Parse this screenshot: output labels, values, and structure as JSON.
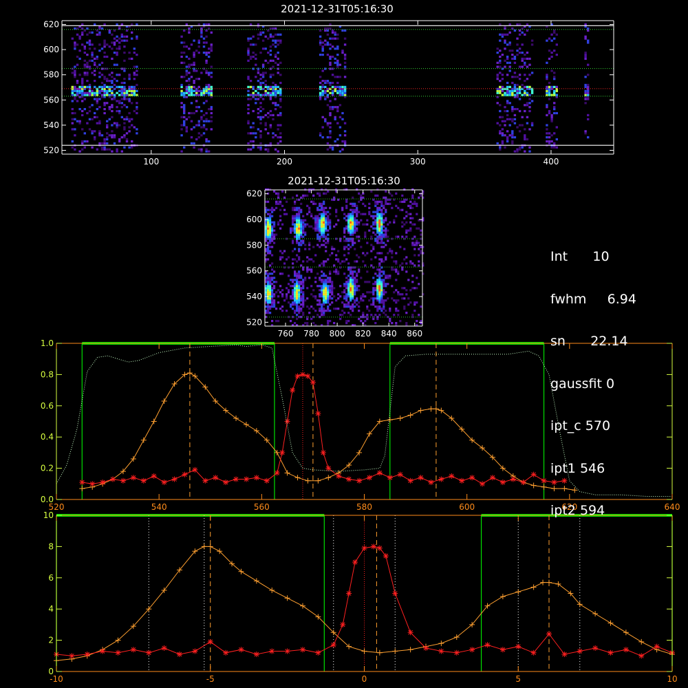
{
  "colors": {
    "background": "#000000",
    "axis_white": "#ffffff",
    "axis_orange": "#ff8c1a",
    "axis_yellow": "#d8ff40",
    "green_band": "#00e000",
    "series_orange": "#ffa030",
    "series_red": "#ff2020",
    "transmission": "#c8ffc8"
  },
  "panels": {
    "top_image": {
      "title": "2021-12-31T05:16:30",
      "xlim": [
        33,
        447
      ],
      "ylim": [
        517,
        623
      ],
      "xticks": [
        100,
        200,
        300,
        400
      ],
      "yticks": [
        520,
        540,
        560,
        580,
        600,
        620
      ],
      "hlines": [
        {
          "y": 616,
          "color": "#30c030",
          "style": "dotted"
        },
        {
          "y": 585,
          "color": "#30c030",
          "style": "dotted"
        },
        {
          "y": 569,
          "color": "#e02020",
          "style": "dotted"
        },
        {
          "y": 563,
          "color": "#30c030",
          "style": "dotted"
        },
        {
          "y": 524,
          "color": "#ffffff",
          "style": "solid"
        },
        {
          "y": 619,
          "color": "#ffffff",
          "style": "solid"
        }
      ],
      "stripes": [
        [
          40,
          90
        ],
        [
          122,
          145
        ],
        [
          172,
          197
        ],
        [
          226,
          246
        ],
        [
          359,
          386
        ],
        [
          396,
          405
        ],
        [
          425,
          428
        ]
      ]
    },
    "mid_image": {
      "title": "2021-12-31T05:16:30",
      "xlim": [
        744,
        866
      ],
      "ylim": [
        517,
        623
      ],
      "xticks": [
        760,
        780,
        800,
        820,
        840,
        860
      ],
      "yticks": [
        520,
        540,
        560,
        580,
        600,
        620
      ],
      "hlines": [
        {
          "y": 616
        },
        {
          "y": 585
        },
        {
          "y": 563
        },
        {
          "y": 524
        }
      ],
      "blobs": [
        [
          746,
          592
        ],
        [
          746,
          542
        ],
        [
          769,
          592
        ],
        [
          768,
          542
        ],
        [
          788,
          596
        ],
        [
          790,
          542
        ],
        [
          810,
          596
        ],
        [
          810,
          545
        ],
        [
          832,
          596
        ],
        [
          832,
          545
        ]
      ]
    }
  },
  "info": {
    "int_label": "Int",
    "int_value": "10",
    "fwhm_label": "fwhm",
    "fwhm_value": "6.94",
    "sn_label": "sn",
    "sn_value": "22.14",
    "gaussfit_label": "gaussfit",
    "gaussfit_value": "0",
    "ipt_c_label": "ipt_c",
    "ipt_c_value": "570",
    "ipt1_label": "ipt1",
    "ipt1_value": "546",
    "ipt2_label": "ipt2",
    "ipt2_value": "594"
  },
  "chart_data": [
    {
      "type": "line",
      "xlim": [
        520,
        640
      ],
      "ylim": [
        0,
        1.0
      ],
      "xticks": [
        520,
        540,
        560,
        580,
        600,
        620,
        640
      ],
      "yticks": [
        0.0,
        0.2,
        0.4,
        0.6,
        0.8,
        1.0
      ],
      "green_bands": [
        [
          525,
          562.5
        ],
        [
          585,
          615
        ]
      ],
      "vlines_orange_dashed": [
        546,
        570,
        594
      ],
      "vlines_red_dotted": [
        568
      ],
      "series": [
        {
          "color": "#ffa030",
          "marker": "plus",
          "x": [
            525,
            527,
            529,
            531,
            533,
            535,
            537,
            539,
            541,
            543,
            545,
            546,
            547,
            549,
            551,
            553,
            555,
            557,
            559,
            561,
            563,
            565,
            567,
            569,
            571,
            573,
            575,
            577,
            579,
            581,
            583,
            585,
            587,
            589,
            591,
            593,
            594,
            595,
            597,
            599,
            601,
            603,
            605,
            607,
            609,
            611,
            613,
            615,
            617,
            619,
            621
          ],
          "y": [
            0.07,
            0.08,
            0.1,
            0.13,
            0.18,
            0.26,
            0.38,
            0.5,
            0.63,
            0.74,
            0.8,
            0.81,
            0.79,
            0.72,
            0.63,
            0.57,
            0.52,
            0.48,
            0.44,
            0.38,
            0.3,
            0.17,
            0.14,
            0.12,
            0.12,
            0.14,
            0.17,
            0.22,
            0.3,
            0.42,
            0.5,
            0.51,
            0.52,
            0.54,
            0.57,
            0.58,
            0.58,
            0.57,
            0.52,
            0.45,
            0.38,
            0.33,
            0.27,
            0.2,
            0.15,
            0.11,
            0.09,
            0.08,
            0.07,
            0.07,
            0.06
          ]
        },
        {
          "color": "#ff2020",
          "marker": "star",
          "x": [
            525,
            527,
            529,
            531,
            533,
            535,
            537,
            539,
            541,
            543,
            545,
            547,
            549,
            551,
            553,
            555,
            557,
            559,
            561,
            563,
            564,
            565,
            566,
            567,
            568,
            569,
            570,
            571,
            572,
            573,
            575,
            577,
            579,
            581,
            583,
            585,
            587,
            589,
            591,
            593,
            595,
            597,
            599,
            601,
            603,
            605,
            607,
            609,
            611,
            613,
            615,
            617,
            619
          ],
          "y": [
            0.11,
            0.1,
            0.11,
            0.13,
            0.12,
            0.14,
            0.12,
            0.15,
            0.11,
            0.13,
            0.16,
            0.19,
            0.12,
            0.14,
            0.11,
            0.13,
            0.13,
            0.14,
            0.12,
            0.17,
            0.3,
            0.5,
            0.7,
            0.79,
            0.8,
            0.79,
            0.75,
            0.55,
            0.3,
            0.2,
            0.15,
            0.13,
            0.12,
            0.14,
            0.17,
            0.14,
            0.16,
            0.12,
            0.14,
            0.11,
            0.13,
            0.15,
            0.12,
            0.14,
            0.1,
            0.14,
            0.11,
            0.13,
            0.11,
            0.16,
            0.12,
            0.11,
            0.12
          ]
        },
        {
          "color": "#c8ffc8",
          "style": "dotted",
          "x": [
            520,
            522,
            524,
            526,
            528,
            530,
            532,
            534,
            536,
            540,
            545,
            550,
            555,
            557,
            560,
            562,
            564,
            566,
            568,
            570,
            575,
            580,
            583,
            584,
            586,
            588,
            592,
            600,
            608,
            612,
            614,
            616,
            618,
            620,
            622,
            625,
            630,
            635,
            640
          ],
          "y": [
            0.1,
            0.22,
            0.45,
            0.82,
            0.91,
            0.92,
            0.9,
            0.88,
            0.89,
            0.94,
            0.97,
            0.98,
            0.99,
            0.98,
            0.99,
            0.97,
            0.65,
            0.3,
            0.2,
            0.19,
            0.18,
            0.19,
            0.2,
            0.28,
            0.85,
            0.92,
            0.93,
            0.93,
            0.93,
            0.95,
            0.92,
            0.8,
            0.45,
            0.12,
            0.05,
            0.03,
            0.03,
            0.02,
            0.02
          ]
        }
      ]
    },
    {
      "type": "line",
      "xlim": [
        -10,
        10
      ],
      "ylim": [
        0,
        10
      ],
      "xticks": [
        -10,
        -5,
        0,
        5,
        10
      ],
      "yticks": [
        0,
        2,
        4,
        6,
        8,
        10
      ],
      "green_bands": [
        [
          -10,
          -1.3
        ],
        [
          3.8,
          10
        ]
      ],
      "vlines_orange_dashed": [
        -5,
        0.4,
        6
      ],
      "vlines_white_dotted": [
        -7,
        -5.2,
        -1,
        1,
        5,
        7
      ],
      "vlines_red_dotted": [
        0
      ],
      "series": [
        {
          "color": "#ffa030",
          "marker": "plus",
          "x": [
            -10,
            -9.5,
            -9,
            -8.5,
            -8,
            -7.5,
            -7,
            -6.5,
            -6,
            -5.5,
            -5.2,
            -5,
            -4.7,
            -4.3,
            -4,
            -3.5,
            -3,
            -2.5,
            -2,
            -1.5,
            -1,
            -0.5,
            0,
            0.5,
            1,
            1.5,
            2,
            2.5,
            3,
            3.5,
            4,
            4.5,
            5,
            5.5,
            5.8,
            6,
            6.3,
            6.7,
            7,
            7.5,
            8,
            8.5,
            9,
            9.5,
            10
          ],
          "y": [
            0.7,
            0.8,
            1.0,
            1.4,
            2.0,
            2.9,
            4.0,
            5.2,
            6.5,
            7.7,
            8.0,
            8.0,
            7.7,
            6.9,
            6.4,
            5.8,
            5.2,
            4.7,
            4.2,
            3.5,
            2.5,
            1.6,
            1.3,
            1.2,
            1.3,
            1.4,
            1.6,
            1.8,
            2.2,
            3.0,
            4.2,
            4.8,
            5.1,
            5.4,
            5.7,
            5.7,
            5.6,
            5.0,
            4.3,
            3.7,
            3.1,
            2.5,
            1.9,
            1.4,
            1.1
          ]
        },
        {
          "color": "#ff2020",
          "marker": "star",
          "x": [
            -10,
            -9.5,
            -9,
            -8.5,
            -8,
            -7.5,
            -7,
            -6.5,
            -6,
            -5.5,
            -5,
            -4.5,
            -4,
            -3.5,
            -3,
            -2.5,
            -2,
            -1.5,
            -1,
            -0.7,
            -0.5,
            -0.3,
            0,
            0.3,
            0.5,
            0.7,
            1,
            1.5,
            2,
            2.5,
            3,
            3.5,
            4,
            4.5,
            5,
            5.5,
            6,
            6.5,
            7,
            7.5,
            8,
            8.5,
            9,
            9.5,
            10
          ],
          "y": [
            1.1,
            1.0,
            1.1,
            1.3,
            1.2,
            1.4,
            1.2,
            1.5,
            1.1,
            1.3,
            1.9,
            1.2,
            1.4,
            1.1,
            1.3,
            1.3,
            1.4,
            1.2,
            1.7,
            3.0,
            5.0,
            7.0,
            7.9,
            8.0,
            7.9,
            7.4,
            5.0,
            2.5,
            1.5,
            1.3,
            1.2,
            1.4,
            1.7,
            1.4,
            1.6,
            1.2,
            2.4,
            1.1,
            1.3,
            1.5,
            1.2,
            1.4,
            1.0,
            1.6,
            1.2
          ]
        }
      ]
    }
  ]
}
